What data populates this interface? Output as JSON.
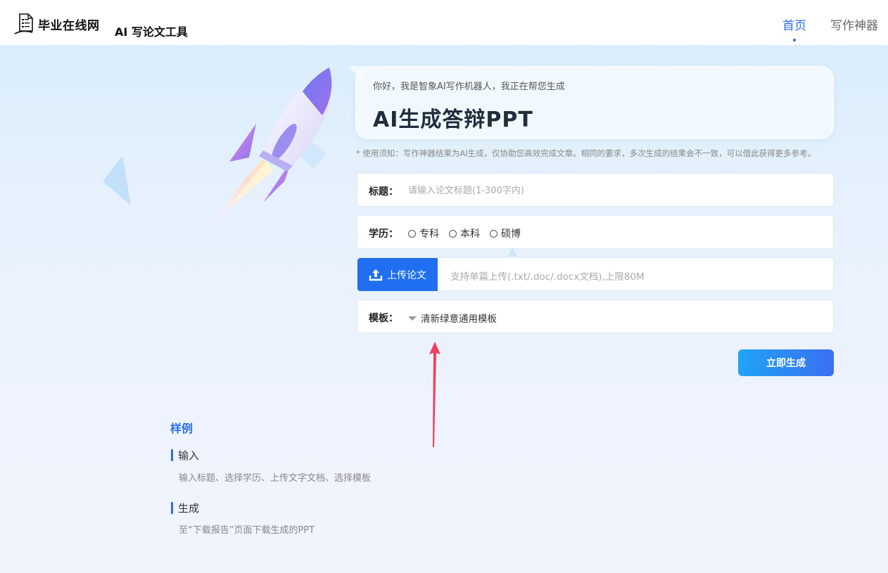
{
  "header": {
    "logo_text": "毕业在线网",
    "subtitle": "AI 写论文工具",
    "nav": [
      {
        "label": "首页",
        "active": true
      },
      {
        "label": "写作神器",
        "active": false
      }
    ]
  },
  "greeting": {
    "subtitle": "你好，我是智象AI写作机器人，我正在帮您生成",
    "title": "AI生成答辩PPT"
  },
  "notice": "* 使用须知：写作神器结果为AI生成，仅协助您高效完成文章。相同的要求，多次生成的结果会不一致，可以借此获得更多参考。",
  "form": {
    "title_label": "标题：",
    "title_placeholder": "请输入论文标题(1-300字内)",
    "title_value": "",
    "education_label": "学历：",
    "education_options": [
      "专科",
      "本科",
      "硕博"
    ],
    "upload_label": "上传论文",
    "upload_hint": "支持单篇上传(.txt/.doc/.docx文档),上限80M",
    "template_label": "模板：",
    "template_value": "清新绿意通用模板",
    "generate_label": "立即生成"
  },
  "examples": {
    "title": "样例",
    "steps": [
      {
        "heading": "输入",
        "desc": "输入标题、选择学历、上传文字文档、选择模板"
      },
      {
        "heading": "生成",
        "desc": "至“下载报告”页面下载生成的PPT"
      }
    ]
  },
  "colors": {
    "primary": "#2a6cf0",
    "upload_button": "#1f6ff0",
    "annotation_arrow": "#f0405a"
  }
}
